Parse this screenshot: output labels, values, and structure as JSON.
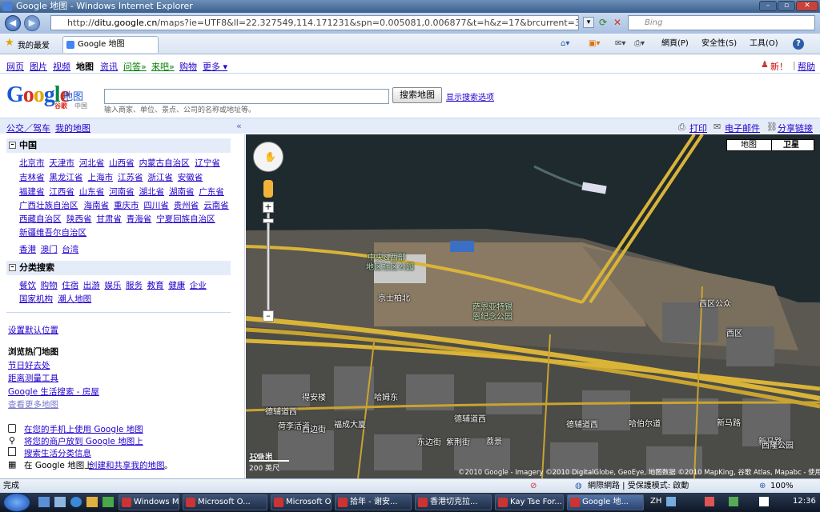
{
  "window": {
    "title": "Google 地图 - Windows Internet Explorer"
  },
  "addressbar": {
    "url_prefix": "http://",
    "url_domain": "ditu.google.cn",
    "url_rest": "/maps?ie=UTF8&ll=22.327549,114.171231&spn=0.005081,0.006877&t=h&z=17&brcurrent=3,0x31508e64e5c642c1:0x",
    "search_placeholder": "Bing"
  },
  "favorites": {
    "label": "我的最爱",
    "tab_title": "Google 地图"
  },
  "commands": {
    "page": "網頁(P)",
    "safety": "安全性(S)",
    "tools": "工具(O)",
    "help": "?"
  },
  "gnav": {
    "items": [
      "网页",
      "图片",
      "视频",
      "地图",
      "资讯",
      "问答»",
      "来吧»",
      "购物",
      "更多 ▾"
    ],
    "new_label": "新！",
    "help_label": "帮助"
  },
  "logo": {
    "text": "Google",
    "sub_cn": "谷歌",
    "sub_label": "中国",
    "product": "地图"
  },
  "search": {
    "button": "搜索地图",
    "show_options": "显示搜索选项",
    "hint": "输入商家、单位、景点、公司的名称或地址等。"
  },
  "bluebar": {
    "transit": "公交／驾车",
    "mymaps": "我的地图",
    "collapse": "«",
    "print": "打印",
    "email": "电子邮件",
    "share": "分享链接"
  },
  "sidebar": {
    "china_header": "中国",
    "provinces": [
      [
        "北京市",
        "天津市",
        "河北省",
        "山西省",
        "内蒙古自治区",
        "辽宁省"
      ],
      [
        "吉林省",
        "黑龙江省",
        "上海市",
        "江苏省",
        "浙江省",
        "安徽省"
      ],
      [
        "福建省",
        "江西省",
        "山东省",
        "河南省",
        "湖北省",
        "湖南省",
        "广东省"
      ],
      [
        "广西壮族自治区",
        "海南省",
        "重庆市",
        "四川省",
        "贵州省",
        "云南省"
      ],
      [
        "西藏自治区",
        "陕西省",
        "甘肃省",
        "青海省",
        "宁夏回族自治区"
      ],
      [
        "新疆维吾尔自治区"
      ],
      [
        "香港",
        "澳门",
        "台湾"
      ]
    ],
    "category_header": "分类搜索",
    "categories": [
      [
        "餐饮",
        "购物",
        "住宿",
        "出游",
        "娱乐",
        "服务",
        "教育",
        "健康",
        "企业"
      ],
      [
        "国家机构",
        "潮人地图"
      ]
    ],
    "set_default": "设置默认位置",
    "hot_title": "浏览热门地图",
    "hot_links": [
      "节日好去处",
      "距离测量工具",
      "Google 生活搜索 - 房屋",
      "查看更多地图"
    ],
    "mobile": "在您的手机上使用 Google 地图",
    "business": "将您的商户放到 Google 地图上",
    "tips": "搜索生活分类信息",
    "create_prefix": "在 Google 地图上",
    "create_link": "创建和共享我的地图",
    "create_suffix": "。"
  },
  "map": {
    "type_map": "地图",
    "type_sat": "卫星",
    "labels": [
      "中央&西部",
      "地区社区公园",
      "京士柏北",
      "萨恩亚特锡",
      "恩纪念公园",
      "西区公众",
      "西区",
      "德辅道西",
      "德辅道西",
      "德辅道西",
      "新马路",
      "哈姆东",
      "得安楼",
      "福成大厦",
      "荷李活道",
      "西边街",
      "哈伯尔道",
      "东边街",
      "紫荆街",
      "荔景",
      "石塘咀",
      "新马路",
      "西隆公园"
    ],
    "scale_m": "100 米",
    "scale_ft": "200 英尺",
    "copyright": "©2010 Google - Imagery ©2010 DigitalGlobe, GeoEye, 地图数据 ©2010 MapKing, 谷歌 Atlas, Mapabc - 使用条款"
  },
  "status": {
    "left": "完成",
    "zone": "網際網路 | 受保護模式: 啟動",
    "zoom": "100%"
  },
  "taskbar": {
    "apps": [
      "Windows M...",
      "Microsoft O...",
      "Microsoft O...",
      "拾年 - 谢安...",
      "香港切克拉...",
      "Kay Tse For...",
      "Google 地..."
    ],
    "lang": "ZH",
    "time": "12:36"
  }
}
